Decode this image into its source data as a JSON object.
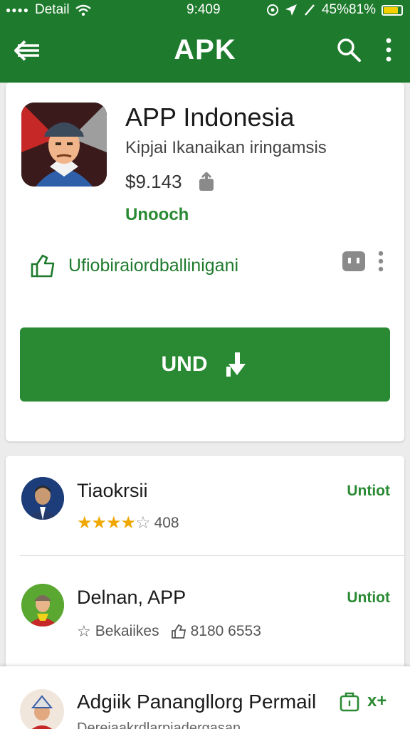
{
  "status_bar": {
    "carrier": "Detail",
    "time": "9:409",
    "battery": "45%81%",
    "battery_level": 0.85,
    "colors": {
      "bar": "#1e7a2c",
      "battery_fill": "#f5d000"
    }
  },
  "app_bar": {
    "title": "APK",
    "icons": {
      "back": "back-arrow-icon",
      "search": "search-icon",
      "more": "more-vert-icon"
    }
  },
  "app": {
    "name": "APP Indonesia",
    "subtitle": "Kipjai Ikanaikan iringamsis",
    "price": "$9.143",
    "status": "Unooch",
    "promo_text": "Ufiobiraiordballinigani",
    "install_label": "UND",
    "colors": {
      "accent": "#2a8a33",
      "link": "#1e7a2c"
    }
  },
  "reviews": [
    {
      "name": "Tiaokrsii",
      "rating": 4,
      "rating_count": "408",
      "action": "Untiot"
    },
    {
      "name": "Delnan, APP",
      "meta_label": "Bekaiikes",
      "meta_count": "8180 6553",
      "action": "Untiot"
    }
  ],
  "bottom_item": {
    "name": "Adgiik Panangllorg Permail",
    "subtitle": "Dereiaakrdlarpiadergasan",
    "action": "x+"
  }
}
